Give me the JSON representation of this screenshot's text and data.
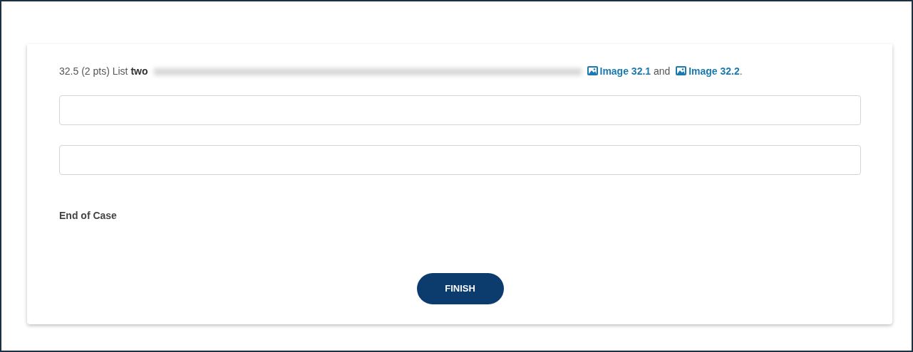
{
  "question": {
    "prompt": "32.5 (2 pts) List **two**",
    "redacted": true,
    "links": [
      {
        "label": "Image 32.1"
      },
      {
        "label": "Image 32.2"
      }
    ],
    "joiner": "and",
    "end": "."
  },
  "answer_fields": [
    {
      "kind": "text"
    },
    {
      "kind": "text"
    }
  ],
  "closing": "End of Case",
  "button": "FINISH"
}
